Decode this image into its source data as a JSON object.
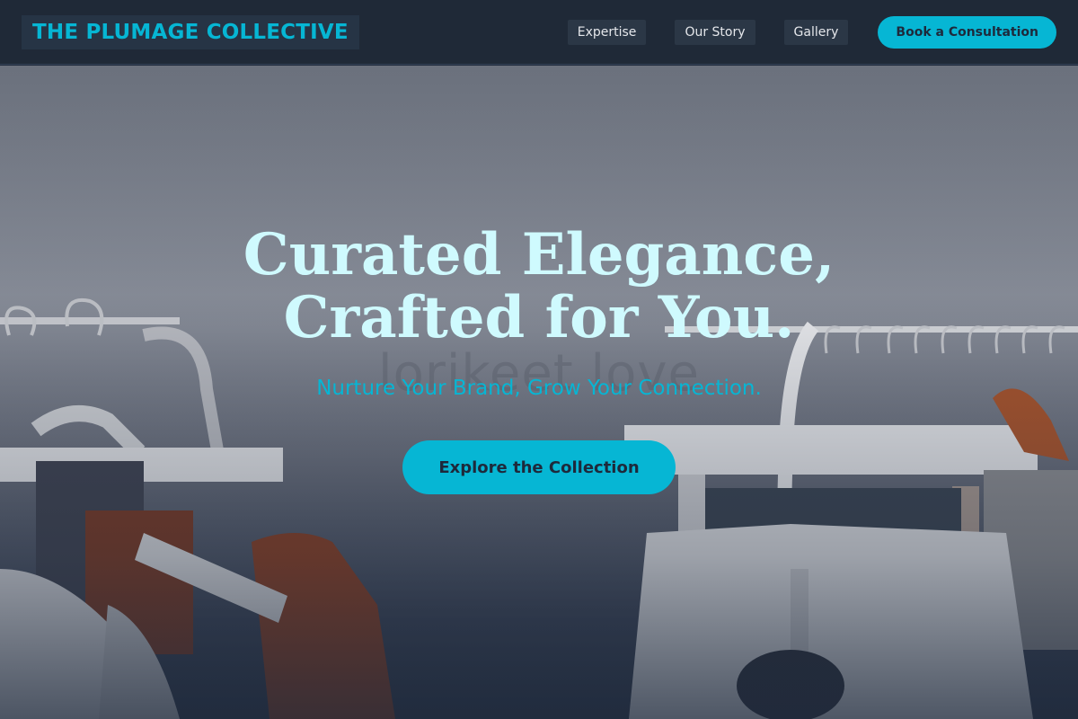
{
  "nav": {
    "brand": "THE PLUMAGE COLLECTIVE",
    "links": [
      "Expertise",
      "Our Story",
      "Gallery"
    ],
    "cta": "Book a Consultation"
  },
  "hero": {
    "watermark": "lorikeet love",
    "headline_line1": "Curated Elegance,",
    "headline_line2": "Crafted for You.",
    "subheadline": "Nurture Your Brand, Grow Your Connection.",
    "cta": "Explore the Collection"
  },
  "colors": {
    "accent": "#06b6d4",
    "nav_bg": "#1f2937",
    "headline": "#cffafe",
    "dark": "#1e293b"
  }
}
